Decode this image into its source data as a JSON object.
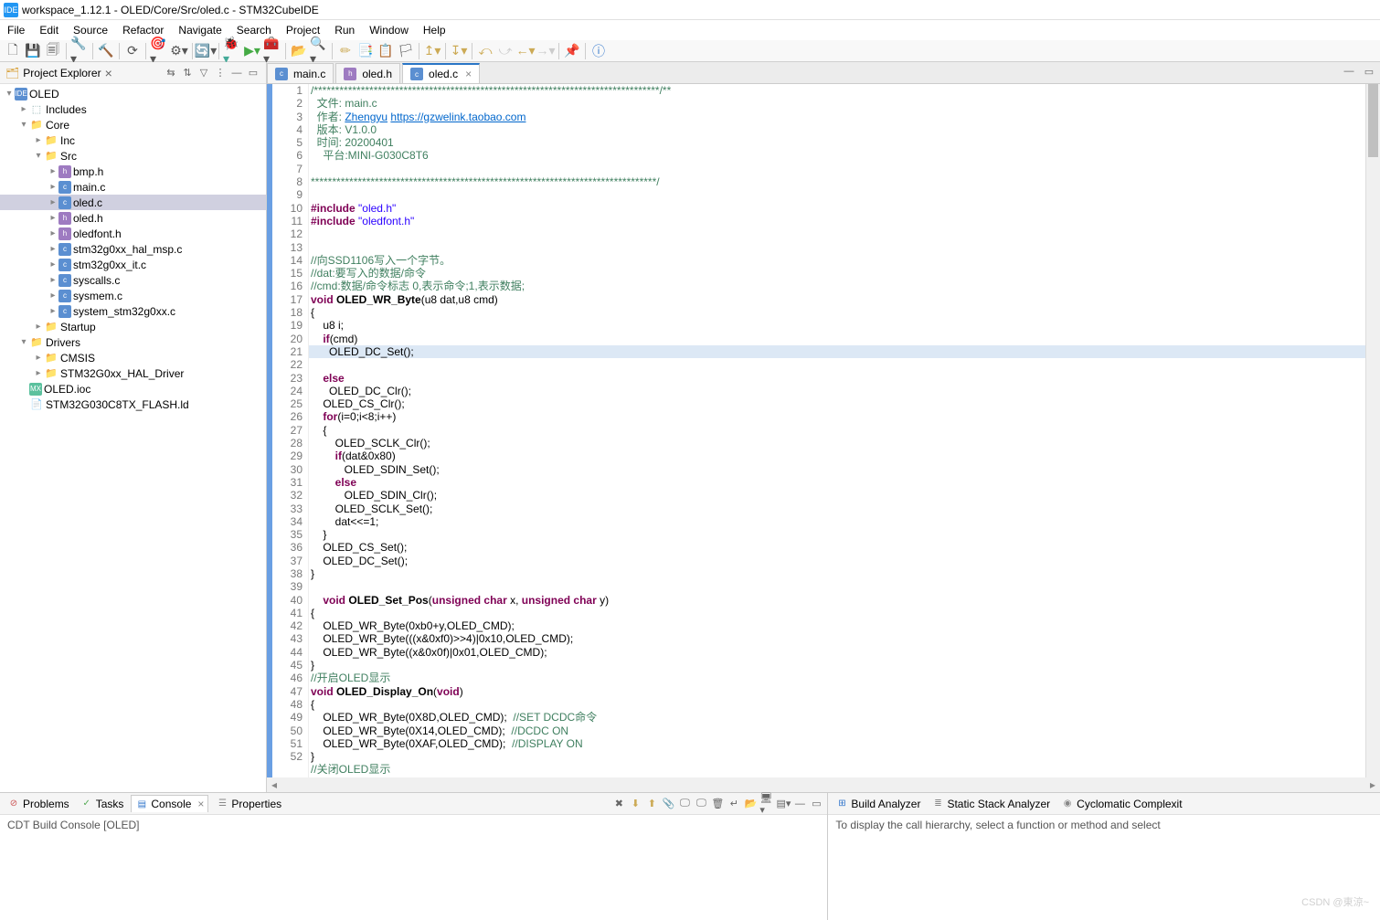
{
  "window": {
    "title": "workspace_1.12.1 - OLED/Core/Src/oled.c - STM32CubeIDE"
  },
  "menu": [
    "File",
    "Edit",
    "Source",
    "Refactor",
    "Navigate",
    "Search",
    "Project",
    "Run",
    "Window",
    "Help"
  ],
  "explorer": {
    "title": "Project Explorer",
    "project": "OLED",
    "includes": "Includes",
    "core": "Core",
    "inc": "Inc",
    "src": "Src",
    "src_files": [
      "bmp.h",
      "main.c",
      "oled.c",
      "oled.h",
      "oledfont.h",
      "stm32g0xx_hal_msp.c",
      "stm32g0xx_it.c",
      "syscalls.c",
      "sysmem.c",
      "system_stm32g0xx.c"
    ],
    "src_selected": "oled.c",
    "startup": "Startup",
    "drivers": "Drivers",
    "drivers_children": [
      "CMSIS",
      "STM32G0xx_HAL_Driver"
    ],
    "ioc": "OLED.ioc",
    "ld": "STM32G030C8TX_FLASH.ld"
  },
  "tabs": [
    {
      "label": "main.c",
      "type": "c"
    },
    {
      "label": "oled.h",
      "type": "h"
    },
    {
      "label": "oled.c",
      "type": "c",
      "active": true,
      "close": true
    }
  ],
  "code": {
    "start_line": 1,
    "highlight_line": 21,
    "lines": [
      {
        "t": "cmt",
        "c": "/*********************************************************************************/**"
      },
      {
        "t": "cmt",
        "c": "  文件: main.c"
      },
      {
        "t": "lnk",
        "c": "  作者: Zhengyu https://gzwelink.taobao.com"
      },
      {
        "t": "cmt",
        "c": "  版本: V1.0.0"
      },
      {
        "t": "cmt",
        "c": "  时间: 20200401"
      },
      {
        "t": "cmt",
        "c": "    平台:MINI-G030C8T6"
      },
      {
        "t": "",
        "c": ""
      },
      {
        "t": "cmt",
        "c": "*********************************************************************************/"
      },
      {
        "t": "",
        "c": ""
      },
      {
        "t": "inc",
        "c": "#include \"oled.h\""
      },
      {
        "t": "inc",
        "c": "#include \"oledfont.h\""
      },
      {
        "t": "",
        "c": ""
      },
      {
        "t": "",
        "c": ""
      },
      {
        "t": "cmt",
        "c": "//向SSD1106写入一个字节。"
      },
      {
        "t": "cmt",
        "c": "//dat:要写入的数据/命令"
      },
      {
        "t": "cmt",
        "c": "//cmd:数据/命令标志 0,表示命令;1,表示数据;"
      },
      {
        "t": "fn",
        "c": "void OLED_WR_Byte(u8 dat,u8 cmd)"
      },
      {
        "t": "",
        "c": "{"
      },
      {
        "t": "",
        "c": "    u8 i;"
      },
      {
        "t": "kw",
        "c": "    if(cmd)"
      },
      {
        "t": "",
        "c": "      OLED_DC_Set();"
      },
      {
        "t": "kw",
        "c": "    else"
      },
      {
        "t": "",
        "c": "      OLED_DC_Clr();"
      },
      {
        "t": "",
        "c": "    OLED_CS_Clr();"
      },
      {
        "t": "kw",
        "c": "    for(i=0;i<8;i++)"
      },
      {
        "t": "",
        "c": "    {"
      },
      {
        "t": "",
        "c": "        OLED_SCLK_Clr();"
      },
      {
        "t": "kw",
        "c": "        if(dat&0x80)"
      },
      {
        "t": "",
        "c": "           OLED_SDIN_Set();"
      },
      {
        "t": "kw",
        "c": "        else"
      },
      {
        "t": "",
        "c": "           OLED_SDIN_Clr();"
      },
      {
        "t": "",
        "c": "        OLED_SCLK_Set();"
      },
      {
        "t": "",
        "c": "        dat<<=1;"
      },
      {
        "t": "",
        "c": "    }"
      },
      {
        "t": "",
        "c": "    OLED_CS_Set();"
      },
      {
        "t": "",
        "c": "    OLED_DC_Set();"
      },
      {
        "t": "",
        "c": "}"
      },
      {
        "t": "",
        "c": ""
      },
      {
        "t": "fn2",
        "c": "    void OLED_Set_Pos(unsigned char x, unsigned char y)"
      },
      {
        "t": "",
        "c": "{"
      },
      {
        "t": "",
        "c": "    OLED_WR_Byte(0xb0+y,OLED_CMD);"
      },
      {
        "t": "",
        "c": "    OLED_WR_Byte(((x&0xf0)>>4)|0x10,OLED_CMD);"
      },
      {
        "t": "",
        "c": "    OLED_WR_Byte((x&0x0f)|0x01,OLED_CMD);"
      },
      {
        "t": "",
        "c": "}"
      },
      {
        "t": "cmt",
        "c": "//开启OLED显示"
      },
      {
        "t": "fn3",
        "c": "void OLED_Display_On(void)"
      },
      {
        "t": "",
        "c": "{"
      },
      {
        "t": "cmtc",
        "c": "    OLED_WR_Byte(0X8D,OLED_CMD);  //SET DCDC命令"
      },
      {
        "t": "cmtc",
        "c": "    OLED_WR_Byte(0X14,OLED_CMD);  //DCDC ON"
      },
      {
        "t": "cmtc",
        "c": "    OLED_WR_Byte(0XAF,OLED_CMD);  //DISPLAY ON"
      },
      {
        "t": "",
        "c": "}"
      },
      {
        "t": "cmt",
        "c": "//关闭OLED显示"
      }
    ]
  },
  "bottom": {
    "left_tabs": [
      "Problems",
      "Tasks",
      "Console",
      "Properties"
    ],
    "console_title": "CDT Build Console [OLED]",
    "right_tabs": [
      "Build Analyzer",
      "Static Stack Analyzer",
      "Cyclomatic Complexit"
    ],
    "right_hint": "To display the call hierarchy, select a function or method and select"
  },
  "watermark": "CSDN @東涼~"
}
